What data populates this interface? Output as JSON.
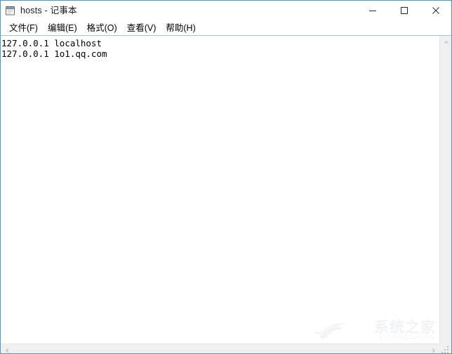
{
  "window": {
    "title": "hosts - 记事本",
    "icon": "notepad-icon",
    "border_color": "#4b97d8",
    "titlebar_background": "#ffffff"
  },
  "window_controls": [
    {
      "name": "minimize",
      "glyph": "—"
    },
    {
      "name": "maximize",
      "glyph": "□"
    },
    {
      "name": "close",
      "glyph": "✕"
    }
  ],
  "menubar": {
    "items": [
      {
        "label": "文件(F)"
      },
      {
        "label": "编辑(E)"
      },
      {
        "label": "格式(O)"
      },
      {
        "label": "查看(V)"
      },
      {
        "label": "帮助(H)"
      }
    ]
  },
  "editor": {
    "lines": [
      "127.0.0.1 localhost",
      "127.0.0.1 1o1.qq.com"
    ],
    "text_color": "#000000",
    "background": "#ffffff"
  },
  "scrollbars": {
    "vertical": {
      "up_arrow": "▲"
    },
    "horizontal": {
      "left_arrow": "◄",
      "right_arrow": "►"
    },
    "track_color": "#f0f0f0"
  },
  "watermark": {
    "chinese": "系统之家",
    "english": "XITONGZHIJIA",
    "color": "#eceff3"
  }
}
